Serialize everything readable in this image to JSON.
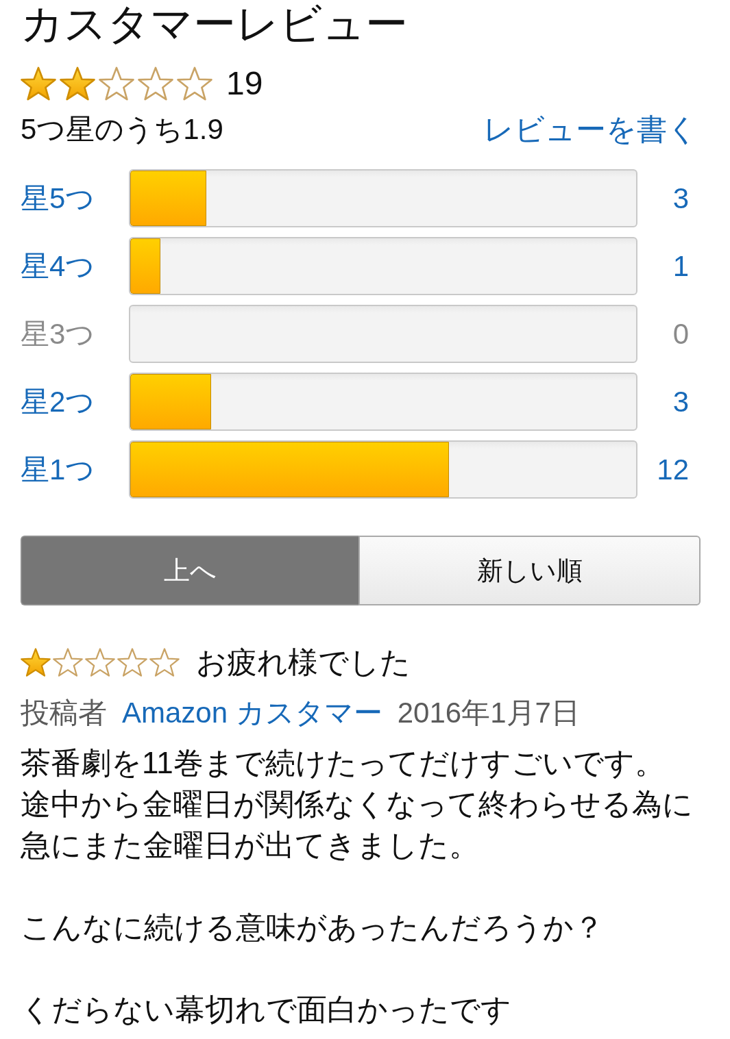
{
  "title": "カスタマーレビュー",
  "summary": {
    "stars": 2,
    "count": "19",
    "average": "5つ星のうち1.9",
    "write_review": "レビューを書く"
  },
  "histogram": [
    {
      "label": "星5つ",
      "level": 0.15,
      "count": "3",
      "disabled": false
    },
    {
      "label": "星4つ",
      "level": 0.06,
      "count": "1",
      "disabled": false
    },
    {
      "label": "星3つ",
      "count": "0",
      "disabled": true
    },
    {
      "label": "星2つ",
      "level": 0.16,
      "count": "3",
      "disabled": false
    },
    {
      "label": "星1つ",
      "level": 0.63,
      "count": "12",
      "disabled": false
    }
  ],
  "sort_tabs": [
    {
      "label": "上へ",
      "selected": true
    },
    {
      "label": "新しい順",
      "selected": false
    }
  ],
  "reviews": [
    {
      "stars": 1,
      "title": "お疲れ様でした",
      "byline_label": "投稿者",
      "author": "Amazon カスタマー",
      "date": "2016年1月7日",
      "paragraphs": [
        [
          "茶番劇を11巻まで続けたってだけすごいです。",
          "途中から金曜日が関係なくなって終わらせる為に急にまた金曜日が出てきました。"
        ],
        [
          "こんなに続ける意味があったんだろうか？"
        ],
        [
          "くだらない幕切れで面白かったです"
        ]
      ]
    }
  ]
}
